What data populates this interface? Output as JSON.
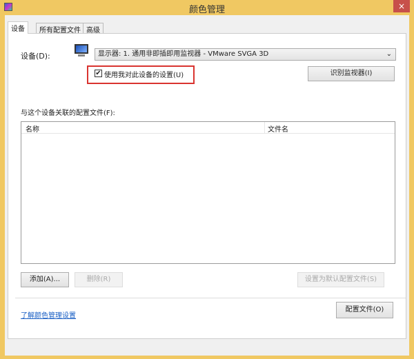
{
  "window": {
    "title": "颜色管理",
    "close": "×"
  },
  "tabs": [
    "设备",
    "所有配置文件",
    "高级"
  ],
  "device": {
    "label": "设备(D):",
    "selected": "显示器: 1. 通用非即插即用监视器 - VMware SVGA 3D",
    "chevron": "⌄",
    "use_settings_label": "使用我对此设备的设置(U)",
    "use_settings_checked": true,
    "identify_button": "识别监视器(I)"
  },
  "profiles": {
    "label": "与这个设备关联的配置文件(F):",
    "columns": [
      "名称",
      "文件名"
    ],
    "rows": []
  },
  "buttons": {
    "add": "添加(A)...",
    "remove": "删除(R)",
    "set_default": "设置为默认配置文件(S)",
    "profiles": "配置文件(O)"
  },
  "link": "了解颜色管理设置"
}
